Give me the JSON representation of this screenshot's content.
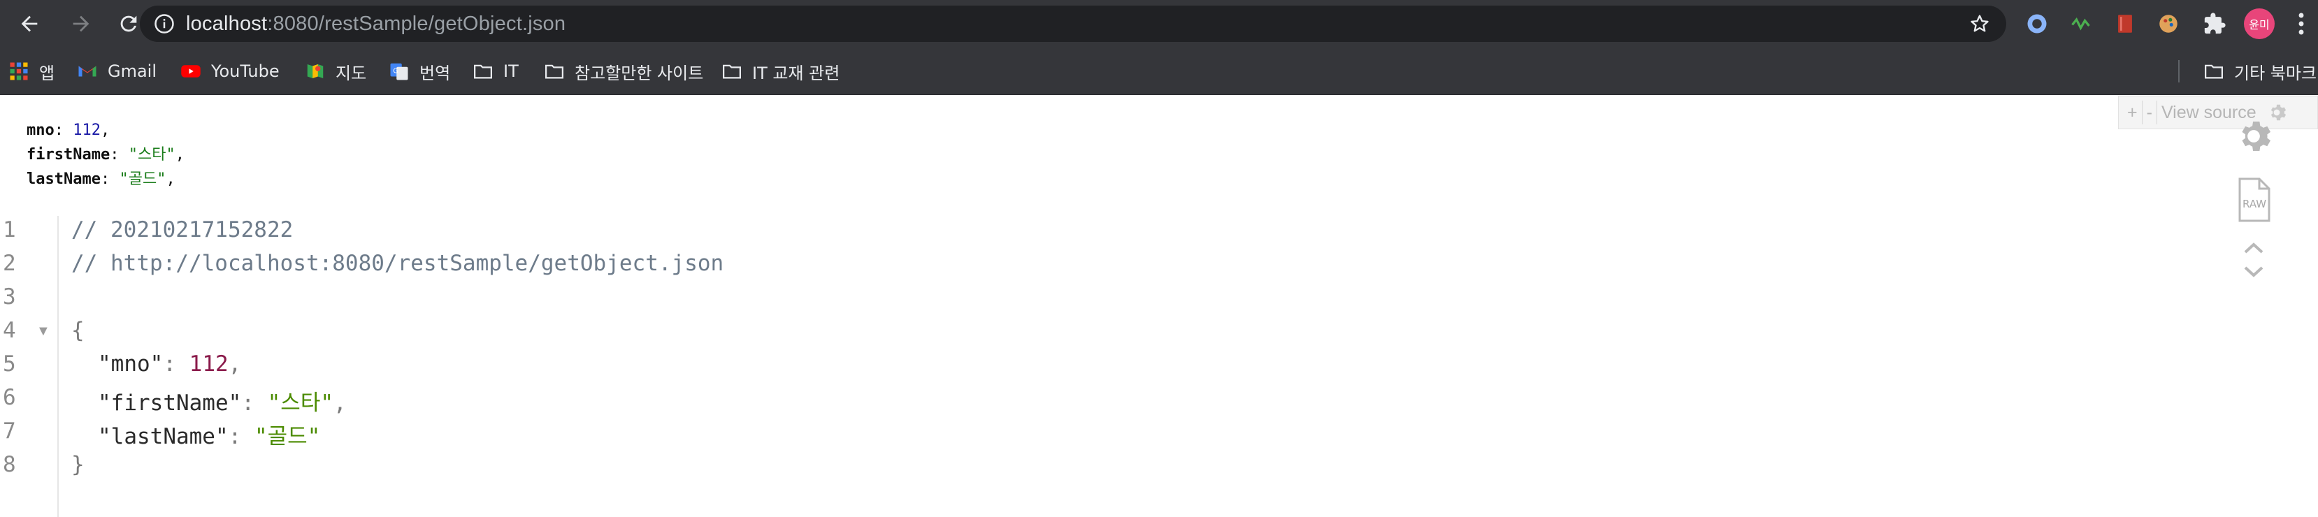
{
  "browser": {
    "url_host": "localhost",
    "url_rest": ":8080/restSample/getObject.json",
    "avatar_text": "윤미",
    "icons": {
      "back": "arrow-left-icon",
      "forward": "arrow-right-icon",
      "reload": "reload-icon",
      "info": "info-icon",
      "bookmark_star": "star-icon",
      "extensions": "puzzle-icon",
      "menu": "more-vert-icon"
    }
  },
  "bookmarks": [
    {
      "label": "앱",
      "icon": "apps-grid-icon"
    },
    {
      "label": "Gmail",
      "icon": "gmail-icon"
    },
    {
      "label": "YouTube",
      "icon": "youtube-icon"
    },
    {
      "label": "지도",
      "icon": "maps-icon"
    },
    {
      "label": "번역",
      "icon": "translate-icon"
    },
    {
      "label": "IT",
      "icon": "folder-icon"
    },
    {
      "label": "참고할만한 사이트",
      "icon": "folder-icon"
    },
    {
      "label": "IT 교재 관련",
      "icon": "folder-icon"
    },
    {
      "label": "기타 북마크",
      "icon": "folder-icon"
    }
  ],
  "preview": [
    {
      "key": "mno",
      "value": "112",
      "type": "number"
    },
    {
      "key": "firstName",
      "value": "\"스타\"",
      "type": "string"
    },
    {
      "key": "lastName",
      "value": "\"골드\"",
      "type": "string"
    }
  ],
  "viewer_controls": {
    "plus": "+",
    "minus": "-",
    "view_source": "View source"
  },
  "code": {
    "line_numbers": [
      "1",
      "2",
      "3",
      "4",
      "5",
      "6",
      "7",
      "8"
    ],
    "comment1": "// 20210217152822",
    "comment2": "// http://localhost:8080/restSample/getObject.json",
    "open_brace": "{",
    "close_brace": "}",
    "entries": [
      {
        "key": "\"mno\"",
        "value": "112",
        "type": "number",
        "comma": ","
      },
      {
        "key": "\"firstName\"",
        "value": "\"스타\"",
        "type": "string",
        "comma": ","
      },
      {
        "key": "\"lastName\"",
        "value": "\"골드\"",
        "type": "string",
        "comma": ""
      }
    ]
  },
  "side_tools": {
    "raw_label": "RAW"
  },
  "colors": {
    "chrome_bar": "#35363a",
    "omnibox": "#202124",
    "json_number": "#8a1a4a",
    "json_string": "#4b8b00",
    "comment": "#6d7b8a"
  }
}
